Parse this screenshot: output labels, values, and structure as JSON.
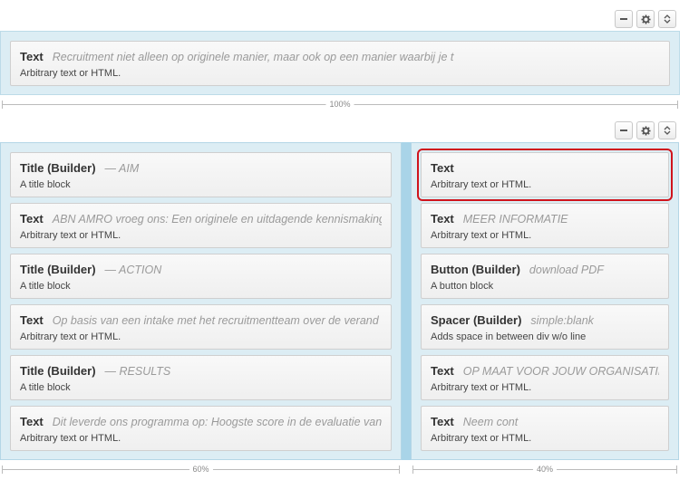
{
  "controls": {
    "collapse_icon": "minus-icon",
    "settings_icon": "gear-icon",
    "move_icon": "up-down-chevron-icon"
  },
  "section1": {
    "width_label": "100%",
    "modules": [
      {
        "title": "Text",
        "subtitle": "Recruitment niet alleen op originele manier, maar ook op een manier waarbij je t",
        "description": "Arbitrary text or HTML."
      }
    ]
  },
  "section2": {
    "left_column": {
      "width_label": "60%",
      "modules": [
        {
          "title": "Title (Builder)",
          "subtitle": "— AIM",
          "description": "A title block"
        },
        {
          "title": "Text",
          "subtitle": "ABN AMRO vroeg ons: Een originele en uitdagende kennismaking",
          "description": "Arbitrary text or HTML."
        },
        {
          "title": "Title (Builder)",
          "subtitle": "— ACTION",
          "description": "A title block"
        },
        {
          "title": "Text",
          "subtitle": "Op basis van een intake met het recruitmentteam over de verand",
          "description": "Arbitrary text or HTML."
        },
        {
          "title": "Title (Builder)",
          "subtitle": "— RESULTS",
          "description": "A title block"
        },
        {
          "title": "Text",
          "subtitle": "Dit leverde ons programma op: Hoogste score in de evaluatie van",
          "description": "Arbitrary text or HTML."
        }
      ]
    },
    "right_column": {
      "width_label": "40%",
      "modules": [
        {
          "title": "Text",
          "subtitle": "",
          "description": "Arbitrary text or HTML.",
          "selected": true
        },
        {
          "title": "Text",
          "subtitle": "MEER INFORMATIE",
          "description": "Arbitrary text or HTML."
        },
        {
          "title": "Button (Builder)",
          "subtitle": "download PDF",
          "description": "A button block"
        },
        {
          "title": "Spacer (Builder)",
          "subtitle": "simple:blank",
          "description": "Adds space in between div w/o line"
        },
        {
          "title": "Text",
          "subtitle": "OP MAAT VOOR JOUW ORGANISATIE",
          "description": "Arbitrary text or HTML."
        },
        {
          "title": "Text",
          "subtitle": "Neem cont",
          "description": "Arbitrary text or HTML."
        }
      ]
    }
  },
  "colors": {
    "section_bg": "#dcedf4",
    "splitter": "#a9d4e8",
    "selection_outline": "#d0141c"
  }
}
